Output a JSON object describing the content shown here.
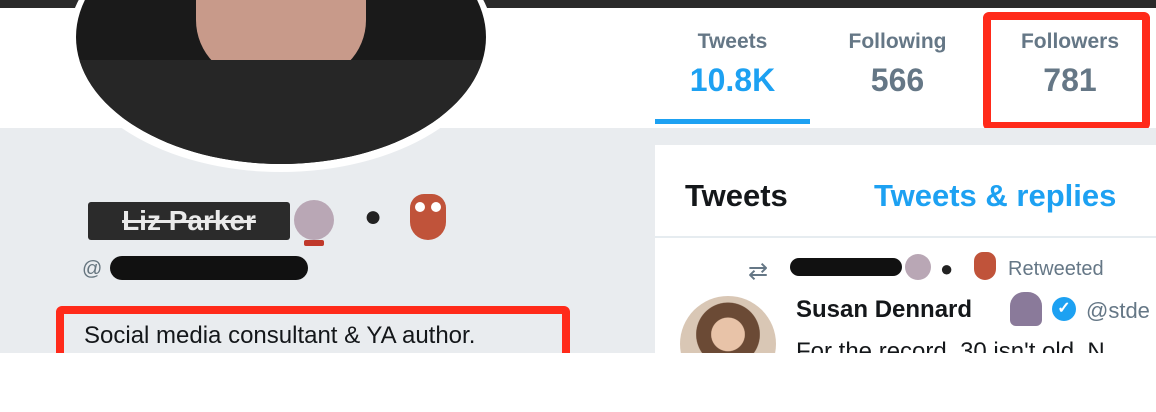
{
  "profile": {
    "name_redacted": "Liz Parker",
    "handle_prefix": "@",
    "bio": "Social media consultant & YA author."
  },
  "stats": [
    {
      "label": "Tweets",
      "value": "10.8K"
    },
    {
      "label": "Following",
      "value": "566"
    },
    {
      "label": "Followers",
      "value": "781"
    }
  ],
  "timeline": {
    "tabs": [
      "Tweets",
      "Tweets & replies"
    ],
    "retweet_label": "Retweeted",
    "tweet": {
      "author_name": "Susan Dennard",
      "author_handle": "@stde",
      "text": "For the record, 30 isn't old. N"
    }
  },
  "colors": {
    "accent": "#1da1f2",
    "highlight_border": "#ff2a1a",
    "muted": "#657786",
    "panel_bg": "#e9ecef"
  },
  "icons": [
    "crystal-ball-icon",
    "ghost-icon",
    "owl-icon",
    "retweet-icon",
    "octopus-icon",
    "verified-badge-icon"
  ]
}
